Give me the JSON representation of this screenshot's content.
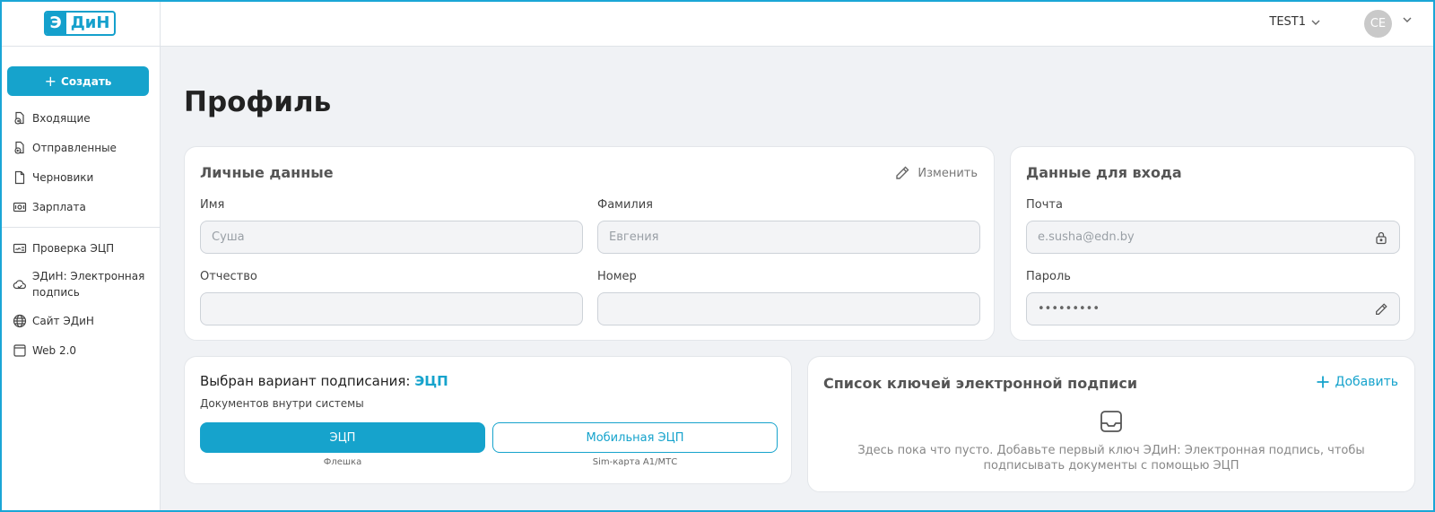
{
  "brand": {
    "logo_e": "Э",
    "logo_din": "ДиН"
  },
  "header": {
    "org": "TEST1",
    "avatar_initials": "CE"
  },
  "sidebar": {
    "create_label": "Создать",
    "items": [
      {
        "label": "Входящие",
        "icon": "inbox-icon"
      },
      {
        "label": "Отправленные",
        "icon": "sent-icon"
      },
      {
        "label": "Черновики",
        "icon": "draft-icon"
      },
      {
        "label": "Зарплата",
        "icon": "salary-icon"
      }
    ],
    "items2": [
      {
        "label": "Проверка ЭЦП",
        "icon": "signature-check-icon"
      },
      {
        "label": "ЭДиН: Электронная подпись",
        "icon": "cloud-sign-icon"
      },
      {
        "label": "Сайт ЭДиН",
        "icon": "globe-icon"
      },
      {
        "label": "Web 2.0",
        "icon": "window-icon"
      }
    ]
  },
  "page": {
    "title": "Профиль"
  },
  "personal": {
    "title": "Личные данные",
    "edit_label": "Изменить",
    "first_name": {
      "label": "Имя",
      "value": "Суша"
    },
    "last_name": {
      "label": "Фамилия",
      "value": "Евгения"
    },
    "patronymic": {
      "label": "Отчество",
      "value": ""
    },
    "number": {
      "label": "Номер",
      "value": ""
    }
  },
  "login": {
    "title": "Данные для входа",
    "email": {
      "label": "Почта",
      "value": "e.susha@edn.by"
    },
    "password": {
      "label": "Пароль",
      "value": "•••••••••"
    }
  },
  "signing": {
    "title_prefix": "Выбран вариант подписания:",
    "title_value": "ЭЦП",
    "subtitle": "Документов внутри системы",
    "options": [
      {
        "label": "ЭЦП",
        "caption": "Флешка",
        "active": true
      },
      {
        "label": "Мобильная ЭЦП",
        "caption": "Sim-карта А1/МТС",
        "active": false
      }
    ]
  },
  "keys": {
    "title": "Список ключей электронной подписи",
    "add_label": "Добавить",
    "empty_text": "Здесь пока что пусто. Добавьте первый ключ ЭДиН: Электронная подпись, чтобы подписывать документы с помощью ЭЦП"
  },
  "colors": {
    "accent": "#16a3cc",
    "background": "#f0f2f5",
    "avatar": "#c9c9c9"
  }
}
